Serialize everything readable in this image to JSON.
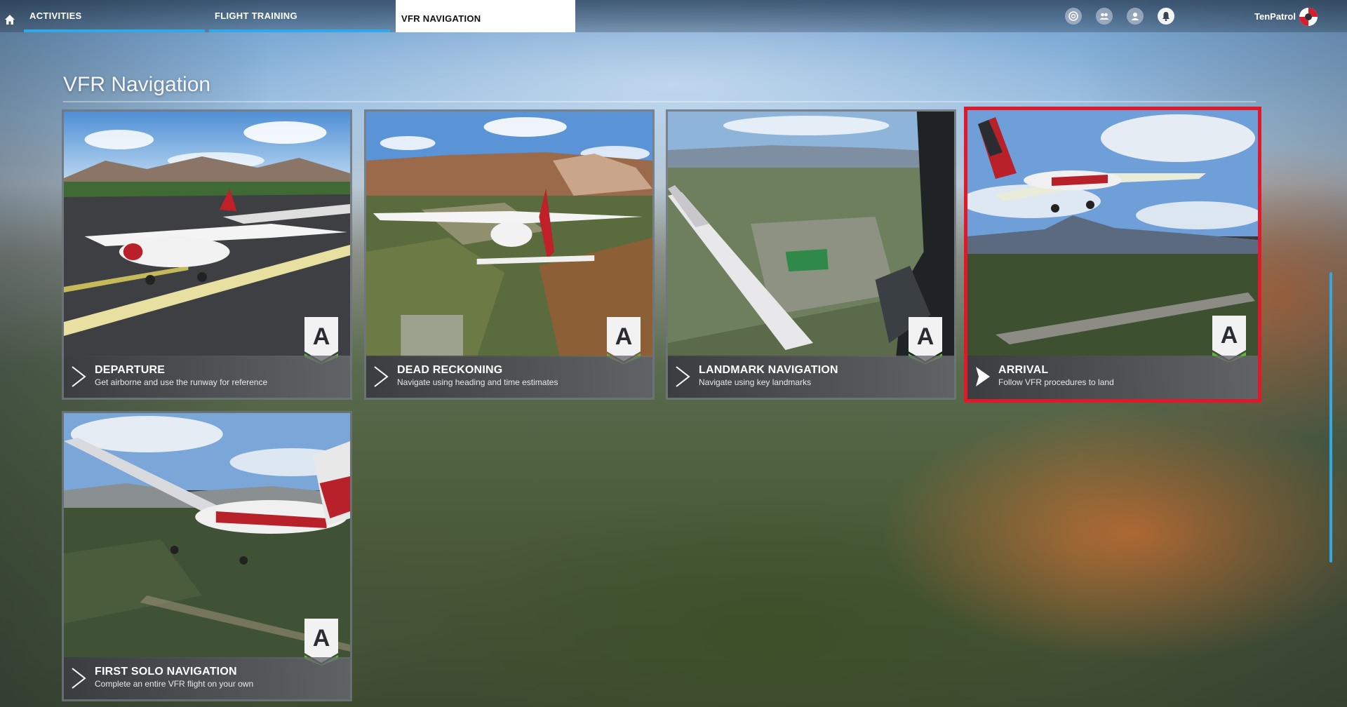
{
  "topbar": {
    "tabs": [
      {
        "label": "ACTIVITIES",
        "state": "breadcrumb"
      },
      {
        "label": "FLIGHT TRAINING",
        "state": "breadcrumb"
      },
      {
        "label": "VFR NAVIGATION",
        "state": "active"
      }
    ],
    "icons": [
      "home-icon",
      "achievements-icon",
      "friends-icon",
      "profile-icon",
      "notifications-icon"
    ],
    "username": "TenPatrol",
    "accent_color": "#2fa9e8"
  },
  "page": {
    "title": "VFR Navigation"
  },
  "lessons": [
    {
      "title": "DEPARTURE",
      "subtitle": "Get airborne and use the runway for reference",
      "grade": "A",
      "selected": false
    },
    {
      "title": "DEAD RECKONING",
      "subtitle": "Navigate using heading and time estimates",
      "grade": "A",
      "selected": false
    },
    {
      "title": "LANDMARK NAVIGATION",
      "subtitle": "Navigate using key landmarks",
      "grade": "A",
      "selected": false
    },
    {
      "title": "ARRIVAL",
      "subtitle": "Follow VFR procedures to land",
      "grade": "A",
      "selected": true
    },
    {
      "title": "FIRST SOLO NAVIGATION",
      "subtitle": "Complete an entire VFR flight on your own",
      "grade": "A",
      "selected": false
    }
  ],
  "colors": {
    "selection": "#e0182a",
    "badge_green": "#5fbf3a"
  }
}
